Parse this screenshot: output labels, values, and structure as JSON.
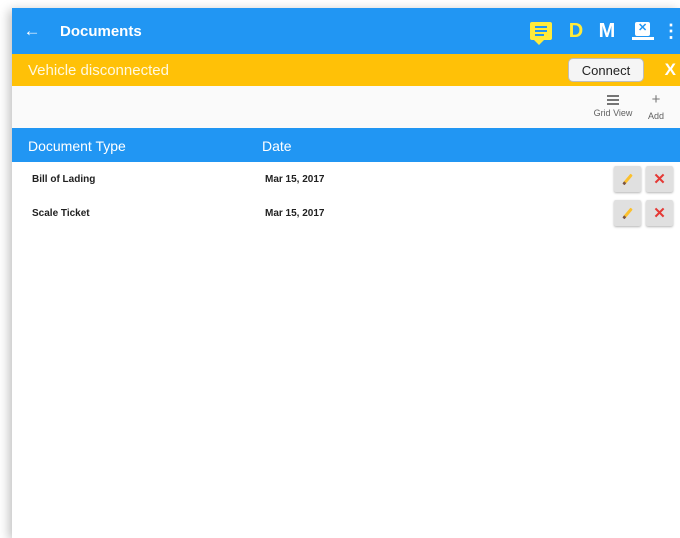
{
  "toolbar": {
    "back_glyph": "←",
    "title": "Documents",
    "status_d": "D",
    "status_m": "M",
    "kebab_glyph": "⋮",
    "icons": [
      "arrow-back-icon",
      "message-icon",
      "eld-disconnected-icon",
      "more-vert-icon"
    ]
  },
  "connection": {
    "status_text": "Vehicle disconnected",
    "connect_label": "Connect",
    "close_label": "X",
    "bar_color": "#ffc107"
  },
  "actions": {
    "grid_view_label": "Grid View",
    "add_glyph": "+",
    "add_label": "Add"
  },
  "table": {
    "headers": [
      "Document Type",
      "Date"
    ],
    "rows": [
      {
        "type": "Bill of Lading",
        "date": "Mar 15, 2017"
      },
      {
        "type": "Scale Ticket",
        "date": "Mar 15, 2017"
      }
    ]
  },
  "colors": {
    "primary": "#2196f3",
    "accent_yellow": "#ffeb3b",
    "delete_red": "#e53935"
  }
}
